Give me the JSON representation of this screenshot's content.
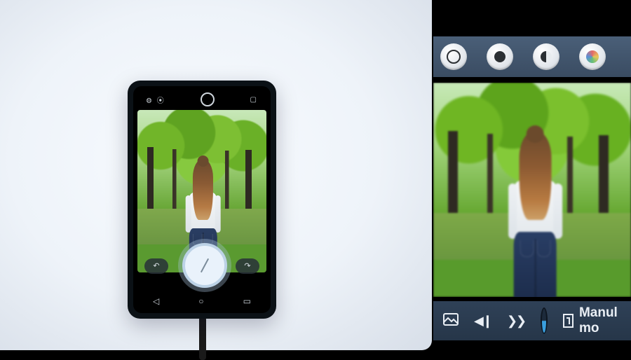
{
  "phone": {
    "top_icons": {
      "left": "⚙ ⦿",
      "right": "▢"
    },
    "controls": {
      "left_pill": "↶",
      "right_pill": "↷"
    },
    "nav": {
      "back": "◁",
      "home": "○",
      "recent": "▭"
    }
  },
  "editor": {
    "modes": [
      {
        "name": "normal-mode",
        "icon": "ring"
      },
      {
        "name": "bw-mode",
        "icon": "dot"
      },
      {
        "name": "portrait-mode",
        "icon": "halfdot"
      },
      {
        "name": "color-mode",
        "icon": "swirl"
      }
    ],
    "bottom": {
      "gallery_icon": "gallery",
      "prev": "◀❙",
      "next": "❯❯",
      "mode_label": "Manul mo"
    }
  }
}
